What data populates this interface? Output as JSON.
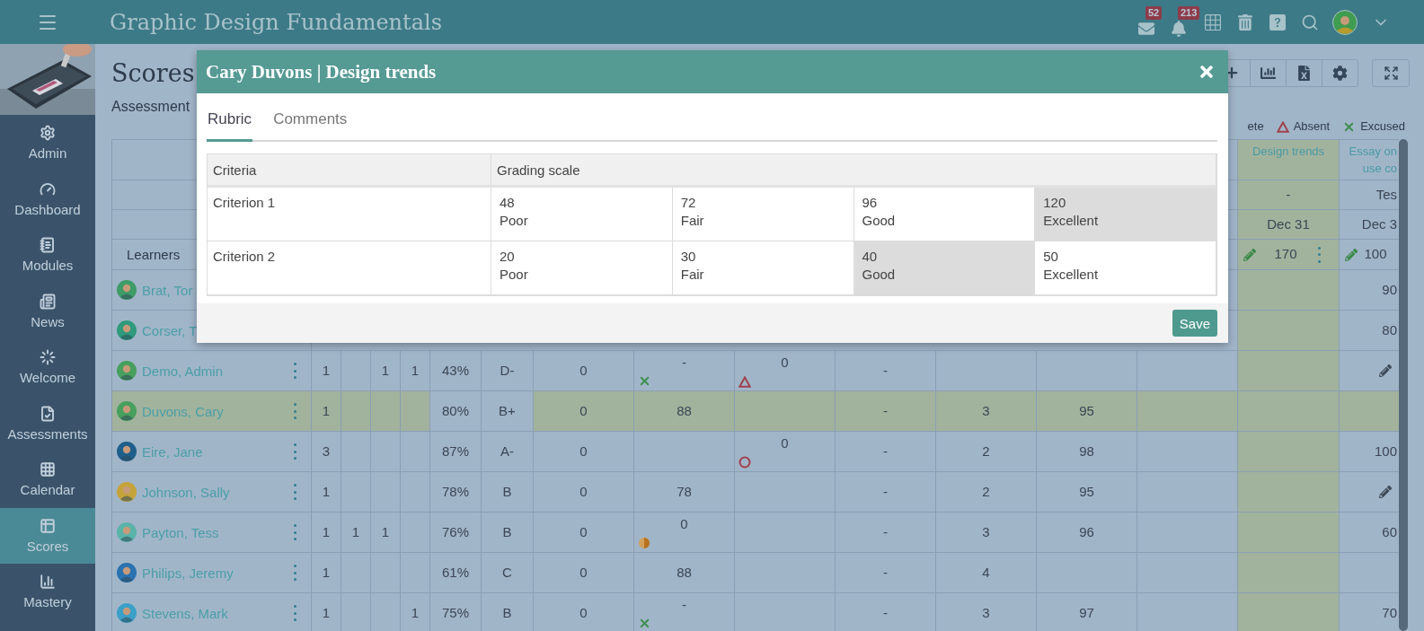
{
  "top_bar": {
    "title": "Graphic Design Fundamentals",
    "notifications": [
      {
        "kind": "mail",
        "badge": "52"
      },
      {
        "kind": "bell",
        "badge": "213"
      }
    ]
  },
  "sidebar": {
    "items": [
      {
        "label": "Admin",
        "kind": "gear",
        "selected": false
      },
      {
        "label": "Dashboard",
        "kind": "gauge",
        "selected": false
      },
      {
        "label": "Modules",
        "kind": "notebook",
        "selected": false
      },
      {
        "label": "News",
        "kind": "newspaper",
        "selected": false
      },
      {
        "label": "Welcome",
        "kind": "loader",
        "selected": false
      },
      {
        "label": "Assessments",
        "kind": "file-check",
        "selected": false
      },
      {
        "label": "Calendar",
        "kind": "grid",
        "selected": false
      },
      {
        "label": "Scores",
        "kind": "table",
        "selected": true
      },
      {
        "label": "Mastery",
        "kind": "bar-chart",
        "selected": false
      }
    ]
  },
  "page": {
    "title": "Scores",
    "subtitle": "Assessment"
  },
  "legend": [
    {
      "label": "ete",
      "kind": "plain"
    },
    {
      "label": "Absent",
      "kind": "absent"
    },
    {
      "label": "Excused",
      "kind": "excused"
    }
  ],
  "gradebook": {
    "learners_label": "Learners",
    "columns": [
      {
        "title": "Design trends",
        "type": "-",
        "date": "Dec 31",
        "points": "170",
        "menu": true
      },
      {
        "title": "Essay on\nuse co",
        "type": "Tes",
        "date": "Dec 3",
        "points": "100",
        "menu": false
      }
    ],
    "rows": [
      {
        "name": "Brat, Tor",
        "color": "#3f9c68",
        "highlighted": false,
        "menu": false,
        "cells": {
          "essay": "90"
        }
      },
      {
        "name": "Corser, T",
        "color": "#2f9a7c",
        "highlighted": false,
        "menu": false,
        "cells": {
          "essay": "80"
        }
      },
      {
        "name": "Demo, Admin",
        "color": "#47a05e",
        "highlighted": false,
        "menu": true,
        "cells": {
          "count_1": "1",
          "count_3": "1",
          "count_4": "1",
          "percent": "43%",
          "grade": "D-",
          "column_7": "0",
          "column_8": {
            "text": "-",
            "kind": "excused"
          },
          "column_9": {
            "text": "0",
            "kind": "absent"
          },
          "column_10": "-",
          "essay": {
            "kind": "edit"
          }
        }
      },
      {
        "name": "Duvons, Cary",
        "color": "#47a05e",
        "highlighted": true,
        "menu": true,
        "cells": {
          "count_1": "1",
          "percent": "80%",
          "grade": "B+",
          "column_7": "0",
          "column_8": "88",
          "column_10": "-",
          "column_11": "3",
          "column_12": "95"
        }
      },
      {
        "name": "Eire, Jane",
        "color": "#1e5f8c",
        "highlighted": false,
        "menu": true,
        "cells": {
          "count_1": "3",
          "percent": "87%",
          "grade": "A-",
          "column_7": "0",
          "column_9": {
            "text": "0",
            "kind": "incomplete"
          },
          "column_10": "-",
          "column_11": "2",
          "column_12": "98",
          "essay": "100"
        }
      },
      {
        "name": "Johnson, Sally",
        "color": "#c4a43a",
        "highlighted": false,
        "menu": true,
        "cells": {
          "count_1": "1",
          "percent": "78%",
          "grade": "B",
          "column_7": "0",
          "column_8": "78",
          "column_10": "-",
          "column_11": "2",
          "column_12": "95",
          "essay": {
            "kind": "edit"
          }
        }
      },
      {
        "name": "Payton, Tess",
        "color": "#5ab3a8",
        "highlighted": false,
        "menu": true,
        "cells": {
          "count_1": "1",
          "count_2": "1",
          "count_3": "1",
          "percent": "76%",
          "grade": "B",
          "column_7": "0",
          "column_8": {
            "text": "0",
            "kind": "late"
          },
          "column_10": "-",
          "column_11": "3",
          "column_12": "96",
          "essay": "60"
        }
      },
      {
        "name": "Philips, Jeremy",
        "color": "#2a72b0",
        "highlighted": false,
        "menu": true,
        "cells": {
          "count_1": "1",
          "percent": "61%",
          "grade": "C",
          "column_7": "0",
          "column_8": "88",
          "column_10": "-",
          "column_11": "4"
        }
      },
      {
        "name": "Stevens, Mark",
        "color": "#3ba0c8",
        "highlighted": false,
        "menu": true,
        "cells": {
          "count_1": "1",
          "count_4": "1",
          "percent": "75%",
          "grade": "B",
          "column_7": "0",
          "column_8": {
            "text": "-",
            "kind": "excused"
          },
          "column_10": "-",
          "column_11": "3",
          "column_12": "97",
          "essay": "70"
        }
      }
    ]
  },
  "modal": {
    "title": "Cary Duvons | Design trends",
    "tabs": [
      {
        "label": "Rubric",
        "selected": true
      },
      {
        "label": "Comments",
        "selected": false
      }
    ],
    "rubric": {
      "columns": [
        "Criteria",
        "Grading scale"
      ],
      "rows": [
        {
          "criterion": "Criterion 1",
          "levels": [
            {
              "points": "48",
              "label": "Poor",
              "selected": false
            },
            {
              "points": "72",
              "label": "Fair",
              "selected": false
            },
            {
              "points": "96",
              "label": "Good",
              "selected": false
            },
            {
              "points": "120",
              "label": "Excellent",
              "selected": true
            }
          ]
        },
        {
          "criterion": "Criterion 2",
          "levels": [
            {
              "points": "20",
              "label": "Poor",
              "selected": false
            },
            {
              "points": "30",
              "label": "Fair",
              "selected": false
            },
            {
              "points": "40",
              "label": "Good",
              "selected": true
            },
            {
              "points": "50",
              "label": "Excellent",
              "selected": false
            }
          ]
        }
      ]
    },
    "save_button": "Save"
  }
}
